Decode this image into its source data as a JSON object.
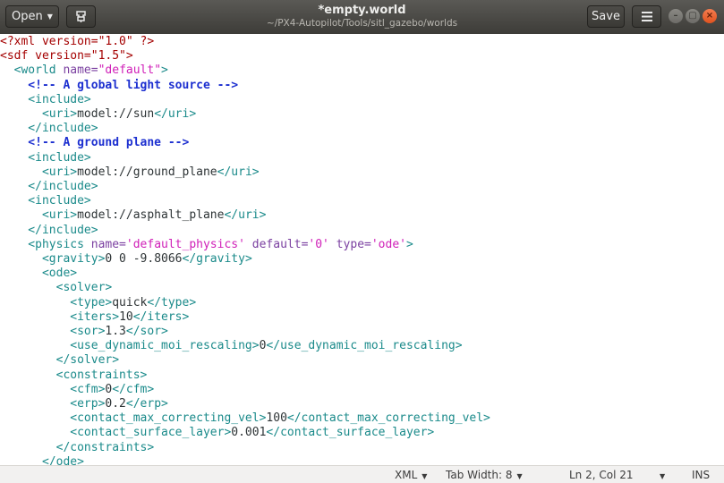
{
  "header": {
    "open_label": "Open",
    "title": "*empty.world",
    "subtitle": "~/PX4-Autopilot/Tools/sitl_gazebo/worlds",
    "save_label": "Save",
    "menu_icon": "hamburger-menu-icon",
    "pin_icon": "document-pin-icon"
  },
  "window_controls": {
    "minimize": "–",
    "maximize": "▢",
    "close": "×"
  },
  "editor": {
    "lines": [
      [
        {
          "t": "<?xml version=\"1.0\" ?>",
          "c": "pi"
        }
      ],
      [
        {
          "t": "<sdf version=\"1.5\">",
          "c": "pi"
        }
      ],
      [
        {
          "t": "  <world ",
          "c": "tag"
        },
        {
          "t": "name=",
          "c": "attr"
        },
        {
          "t": "\"default\"",
          "c": "val"
        },
        {
          "t": ">",
          "c": "tag"
        }
      ],
      [
        {
          "t": "    <!-- A global light source -->",
          "c": "cmt"
        }
      ],
      [
        {
          "t": "    <include>",
          "c": "tag"
        }
      ],
      [
        {
          "t": "      <uri>",
          "c": "tag"
        },
        {
          "t": "model://sun",
          "c": "txt"
        },
        {
          "t": "</uri>",
          "c": "tag"
        }
      ],
      [
        {
          "t": "    </include>",
          "c": "tag"
        }
      ],
      [
        {
          "t": "    <!-- A ground plane -->",
          "c": "cmt"
        }
      ],
      [
        {
          "t": "    <include>",
          "c": "tag"
        }
      ],
      [
        {
          "t": "      <uri>",
          "c": "tag"
        },
        {
          "t": "model://ground_plane",
          "c": "txt"
        },
        {
          "t": "</uri>",
          "c": "tag"
        }
      ],
      [
        {
          "t": "    </include>",
          "c": "tag"
        }
      ],
      [
        {
          "t": "    <include>",
          "c": "tag"
        }
      ],
      [
        {
          "t": "      <uri>",
          "c": "tag"
        },
        {
          "t": "model://asphalt_plane",
          "c": "txt"
        },
        {
          "t": "</uri>",
          "c": "tag"
        }
      ],
      [
        {
          "t": "    </include>",
          "c": "tag"
        }
      ],
      [
        {
          "t": "    <physics ",
          "c": "tag"
        },
        {
          "t": "name=",
          "c": "attr"
        },
        {
          "t": "'default_physics'",
          "c": "val"
        },
        {
          "t": " default=",
          "c": "attr"
        },
        {
          "t": "'0'",
          "c": "val"
        },
        {
          "t": " type=",
          "c": "attr"
        },
        {
          "t": "'ode'",
          "c": "val"
        },
        {
          "t": ">",
          "c": "tag"
        }
      ],
      [
        {
          "t": "      <gravity>",
          "c": "tag"
        },
        {
          "t": "0 0 -9.8066",
          "c": "txt"
        },
        {
          "t": "</gravity>",
          "c": "tag"
        }
      ],
      [
        {
          "t": "      <ode>",
          "c": "tag"
        }
      ],
      [
        {
          "t": "        <solver>",
          "c": "tag"
        }
      ],
      [
        {
          "t": "          <type>",
          "c": "tag"
        },
        {
          "t": "quick",
          "c": "txt"
        },
        {
          "t": "</type>",
          "c": "tag"
        }
      ],
      [
        {
          "t": "          <iters>",
          "c": "tag"
        },
        {
          "t": "10",
          "c": "txt"
        },
        {
          "t": "</iters>",
          "c": "tag"
        }
      ],
      [
        {
          "t": "          <sor>",
          "c": "tag"
        },
        {
          "t": "1.3",
          "c": "txt"
        },
        {
          "t": "</sor>",
          "c": "tag"
        }
      ],
      [
        {
          "t": "          <use_dynamic_moi_rescaling>",
          "c": "tag"
        },
        {
          "t": "0",
          "c": "txt"
        },
        {
          "t": "</use_dynamic_moi_rescaling>",
          "c": "tag"
        }
      ],
      [
        {
          "t": "        </solver>",
          "c": "tag"
        }
      ],
      [
        {
          "t": "        <constraints>",
          "c": "tag"
        }
      ],
      [
        {
          "t": "          <cfm>",
          "c": "tag"
        },
        {
          "t": "0",
          "c": "txt"
        },
        {
          "t": "</cfm>",
          "c": "tag"
        }
      ],
      [
        {
          "t": "          <erp>",
          "c": "tag"
        },
        {
          "t": "0.2",
          "c": "txt"
        },
        {
          "t": "</erp>",
          "c": "tag"
        }
      ],
      [
        {
          "t": "          <contact_max_correcting_vel>",
          "c": "tag"
        },
        {
          "t": "100",
          "c": "txt"
        },
        {
          "t": "</contact_max_correcting_vel>",
          "c": "tag"
        }
      ],
      [
        {
          "t": "          <contact_surface_layer>",
          "c": "tag"
        },
        {
          "t": "0.001",
          "c": "txt"
        },
        {
          "t": "</contact_surface_layer>",
          "c": "tag"
        }
      ],
      [
        {
          "t": "        </constraints>",
          "c": "tag"
        }
      ],
      [
        {
          "t": "      </ode>",
          "c": "tag"
        }
      ]
    ]
  },
  "statusbar": {
    "language": "XML",
    "tab_width": "Tab Width: 8",
    "position": "Ln 2, Col 21",
    "mode": "INS"
  }
}
